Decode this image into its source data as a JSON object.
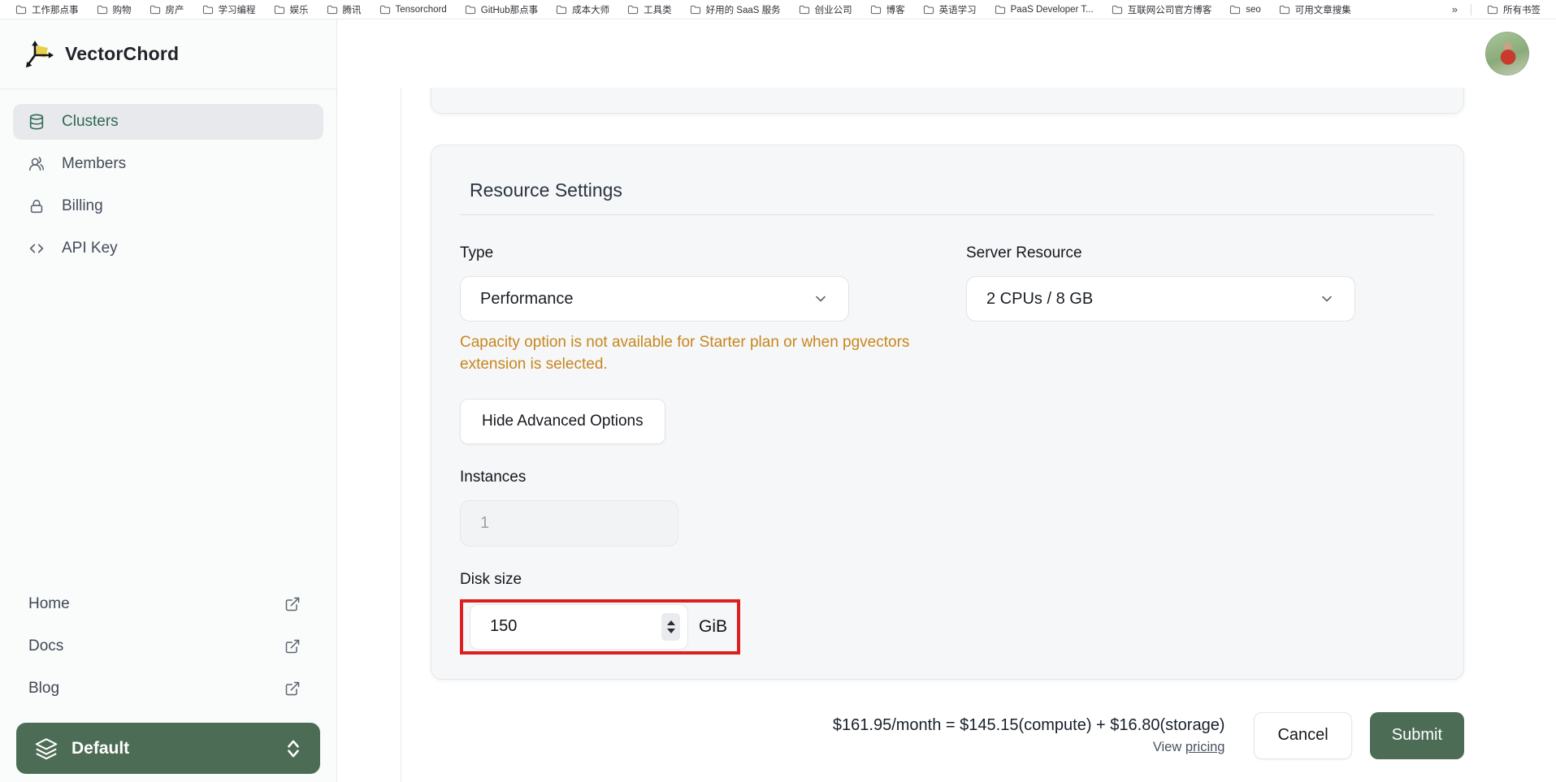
{
  "bookmarks": {
    "items": [
      "工作那点事",
      "购物",
      "房产",
      "学习编程",
      "娱乐",
      "腾讯",
      "Tensorchord",
      "GitHub那点事",
      "成本大师",
      "工具类",
      "好用的 SaaS 服务",
      "创业公司",
      "博客",
      "英语学习",
      "PaaS Developer T...",
      "互联网公司官方博客",
      "seo",
      "可用文章搜集"
    ],
    "overflow_chevron": "»",
    "all_bookmarks": "所有书签"
  },
  "sidebar": {
    "brand": "VectorChord",
    "nav": [
      {
        "label": "Clusters",
        "icon": "database-icon",
        "active": true
      },
      {
        "label": "Members",
        "icon": "users-icon",
        "active": false
      },
      {
        "label": "Billing",
        "icon": "lock-icon",
        "active": false
      },
      {
        "label": "API Key",
        "icon": "code-icon",
        "active": false
      }
    ],
    "links": [
      {
        "label": "Home",
        "icon": "external-link-icon"
      },
      {
        "label": "Docs",
        "icon": "external-link-icon"
      },
      {
        "label": "Blog",
        "icon": "external-link-icon"
      }
    ],
    "workspace": {
      "label": "Default"
    }
  },
  "main": {
    "panel_title": "Resource Settings",
    "fields": {
      "type": {
        "label": "Type",
        "value": "Performance"
      },
      "server_resource": {
        "label": "Server Resource",
        "value": "2 CPUs / 8 GB"
      },
      "warning": "Capacity option is not available for Starter plan or when pgvectors extension is selected.",
      "advanced_button": "Hide Advanced Options",
      "instances": {
        "label": "Instances",
        "placeholder": "1"
      },
      "disk_size": {
        "label": "Disk size",
        "value": "150",
        "unit": "GiB"
      }
    },
    "footer": {
      "price_summary": "$161.95/month = $145.15(compute) + $16.80(storage)",
      "view_prefix": "View",
      "pricing_link": "pricing",
      "cancel": "Cancel",
      "submit": "Submit"
    }
  },
  "colors": {
    "accent_green": "#4d6c55",
    "nav_active_green": "#2e6a4f",
    "warning_orange": "#c8861e",
    "annotation_red": "#de1f1f",
    "brand_yellow": "#e8d14a",
    "panel_bg": "#f6f7f8"
  }
}
